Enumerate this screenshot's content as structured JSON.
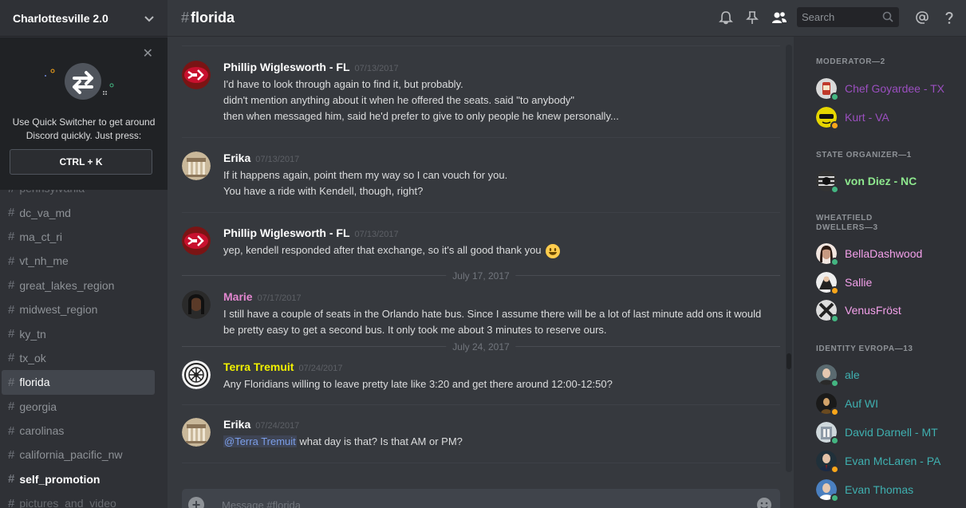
{
  "guild": {
    "name": "Charlottesville 2.0"
  },
  "quick_switcher": {
    "line1": "Use Quick Switcher to get around",
    "line2": "Discord quickly. Just press:",
    "shortcut": "CTRL + K"
  },
  "channels": [
    {
      "name": "pennsylvania",
      "state": "ghost"
    },
    {
      "name": "dc_va_md",
      "state": "normal"
    },
    {
      "name": "ma_ct_ri",
      "state": "normal"
    },
    {
      "name": "vt_nh_me",
      "state": "normal"
    },
    {
      "name": "great_lakes_region",
      "state": "normal"
    },
    {
      "name": "midwest_region",
      "state": "normal"
    },
    {
      "name": "ky_tn",
      "state": "normal"
    },
    {
      "name": "tx_ok",
      "state": "normal"
    },
    {
      "name": "florida",
      "state": "active"
    },
    {
      "name": "georgia",
      "state": "normal"
    },
    {
      "name": "carolinas",
      "state": "normal"
    },
    {
      "name": "california_pacific_nw",
      "state": "normal"
    },
    {
      "name": "self_promotion",
      "state": "bold"
    },
    {
      "name": "pictures_and_video",
      "state": "ghost"
    }
  ],
  "header": {
    "hash": "#",
    "channel": "florida",
    "search_placeholder": "Search",
    "icons": [
      "bell-icon",
      "pin-icon",
      "members-icon",
      "search-icon",
      "mention-icon",
      "help-icon"
    ]
  },
  "messages": [
    {
      "author": "Phillip Wiglesworth - FL",
      "author_color": "#ffffff",
      "timestamp": "07/13/2017",
      "avatar": "chiefs-logo",
      "lines": [
        "I'd have to look through again to find it, but probably.",
        "didn't mention anything about it when he offered the seats.  said \"to anybody\"",
        "then when messaged him, said he'd prefer to give to only people he knew personally..."
      ]
    },
    {
      "author": "Erika",
      "author_color": "#ffffff",
      "timestamp": "07/13/2017",
      "avatar": "building-photo",
      "lines": [
        "If it happens again, point them my way so I can vouch for you.",
        "You have a ride with Kendell, though, right?"
      ]
    },
    {
      "author": "Phillip Wiglesworth - FL",
      "author_color": "#ffffff",
      "timestamp": "07/13/2017",
      "avatar": "chiefs-logo",
      "lines": [
        "yep, kendell responded after that exchange, so it's all good thank you"
      ],
      "emoji": "smiley-emoji"
    },
    {
      "author": "Marie",
      "author_color": "#e387d0",
      "timestamp": "07/17/2017",
      "avatar": "portrait-photo",
      "lines": [
        "I still have a couple of seats in the Orlando hate bus. Since I assume there will be a lot of last minute add ons it would",
        "be pretty easy to get a second bus. It only took me about 3 minutes to reserve ours."
      ]
    },
    {
      "author": "Terra Tremuit",
      "author_color": "#f1f101",
      "timestamp": "07/24/2017",
      "avatar": "emblem",
      "lines": [
        "Any Floridians willing to leave pretty late like 3:20 and get there around 12:00-12:50?"
      ]
    },
    {
      "author": "Erika",
      "author_color": "#ffffff",
      "timestamp": "07/24/2017",
      "avatar": "building-photo",
      "mention": "@Terra Tremuit",
      "lines": [
        " what day is that? Is that AM or PM?"
      ]
    }
  ],
  "date_dividers": [
    "July 17, 2017",
    "July 24, 2017"
  ],
  "composer": {
    "placeholder": "Message #florida"
  },
  "member_groups": [
    {
      "title": "MODERATOR—2",
      "members": [
        {
          "name": "Chef Goyardee - TX",
          "color": "#9b4fc0",
          "status": "online"
        },
        {
          "name": "Kurt - VA",
          "color": "#9b4fc0",
          "status": "idle"
        }
      ]
    },
    {
      "title": "STATE ORGANIZER—1",
      "members": [
        {
          "name": "von Diez - NC",
          "color": "#8ee88e",
          "status": "online",
          "bold": true
        }
      ]
    },
    {
      "title": "WHEATFIELD DWELLERS—3",
      "title_line1": "WHEATFIELD",
      "title_line2": "DWELLERS—3",
      "members": [
        {
          "name": "BellaDashwood",
          "color": "#f3a0ea",
          "status": "online"
        },
        {
          "name": "Sallie",
          "color": "#f3a0ea",
          "status": "idle"
        },
        {
          "name": "VenusFröst",
          "color": "#f3a0ea",
          "status": "online"
        }
      ]
    },
    {
      "title": "IDENTITY EVROPA—13",
      "members": [
        {
          "name": "ale",
          "color": "#3fb0b0",
          "status": "online"
        },
        {
          "name": "Auf WI",
          "color": "#3fb0b0",
          "status": "idle"
        },
        {
          "name": "David Darnell - MT",
          "color": "#3fb0b0",
          "status": "online"
        },
        {
          "name": "Evan McLaren - PA",
          "color": "#3fb0b0",
          "status": "idle"
        },
        {
          "name": "Evan Thomas",
          "color": "#3fb0b0",
          "status": "online"
        }
      ]
    }
  ],
  "colors": {
    "online": "#43b581",
    "idle": "#faa61a"
  }
}
